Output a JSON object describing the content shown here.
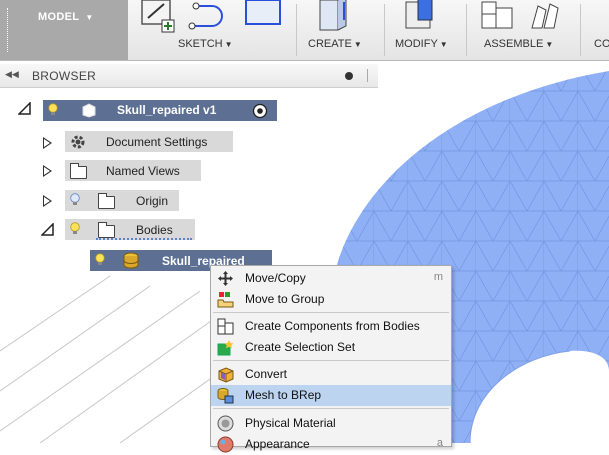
{
  "toolbar": {
    "model_label": "MODEL",
    "model_arrow": "▼",
    "groups": [
      {
        "label": "SKETCH",
        "arrow": "▼"
      },
      {
        "label": "CREATE",
        "arrow": "▼"
      },
      {
        "label": "MODIFY",
        "arrow": "▼"
      },
      {
        "label": "ASSEMBLE",
        "arrow": "▼"
      },
      {
        "label": "CO",
        "arrow": ""
      }
    ]
  },
  "browser": {
    "title": "BROWSER",
    "collapse_icon": "◀◀",
    "root": {
      "label": "Skull_repaired v1"
    },
    "items": [
      {
        "label": "Document Settings",
        "icon": "gear-icon"
      },
      {
        "label": "Named Views",
        "icon": "folder-icon"
      },
      {
        "label": "Origin",
        "icon": "folder-icon"
      },
      {
        "label": "Bodies",
        "icon": "folder-icon"
      }
    ],
    "selected_body": {
      "label": "Skull_repaired"
    }
  },
  "context_menu": {
    "items": [
      {
        "label": "Move/Copy",
        "shortcut": "m",
        "icon": "move-icon"
      },
      {
        "label": "Move to Group",
        "shortcut": "",
        "icon": "move-to-group-icon"
      },
      {
        "label": "Create Components from Bodies",
        "shortcut": "",
        "icon": "create-components-icon"
      },
      {
        "label": "Create Selection Set",
        "shortcut": "",
        "icon": "selection-set-icon"
      },
      {
        "label": "Convert",
        "shortcut": "",
        "icon": "convert-icon"
      },
      {
        "label": "Mesh to BRep",
        "shortcut": "",
        "icon": "mesh-to-brep-icon",
        "highlighted": true
      },
      {
        "label": "Physical Material",
        "shortcut": "",
        "icon": "physical-material-icon"
      },
      {
        "label": "Appearance",
        "shortcut": "a",
        "icon": "appearance-icon"
      }
    ]
  },
  "colors": {
    "mesh_fill": "#8fb0f4",
    "mesh_edge": "#6f93dd",
    "highlight": "#bcd4f0",
    "node_bg": "#d9d9d9",
    "selected_bg": "#6c7ea0"
  }
}
